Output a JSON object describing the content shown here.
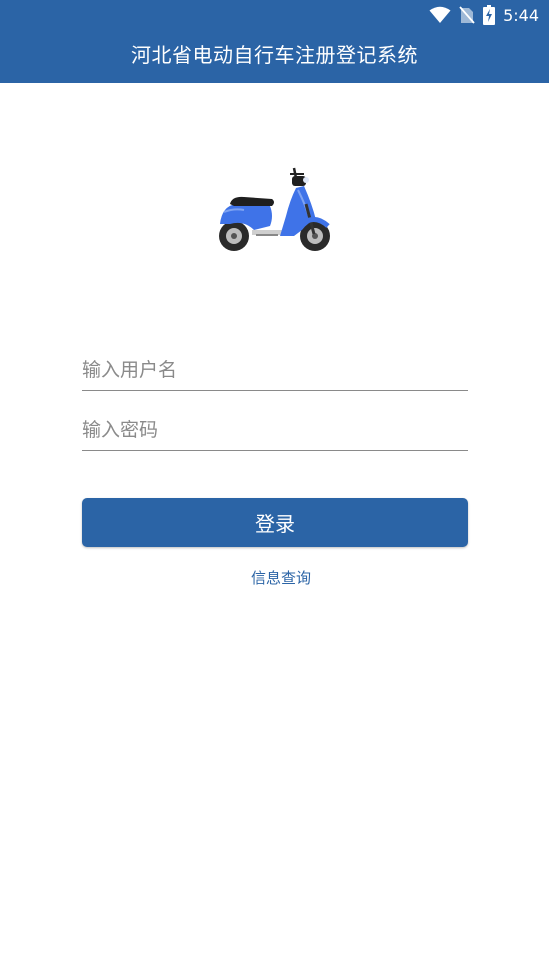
{
  "status_bar": {
    "time": "5:44",
    "icons": [
      "wifi-icon",
      "no-sim-icon",
      "battery-charging-icon"
    ]
  },
  "header": {
    "title": "河北省电动自行车注册登记系统"
  },
  "logo": {
    "icon": "scooter-icon",
    "color": "#3f73e8"
  },
  "form": {
    "username_placeholder": "输入用户名",
    "username_value": "",
    "password_placeholder": "输入密码",
    "password_value": "",
    "login_label": "登录",
    "info_link_label": "信息查询"
  },
  "colors": {
    "primary": "#2b64a6",
    "link": "#2b64a6",
    "underline": "#8a8a8a"
  }
}
